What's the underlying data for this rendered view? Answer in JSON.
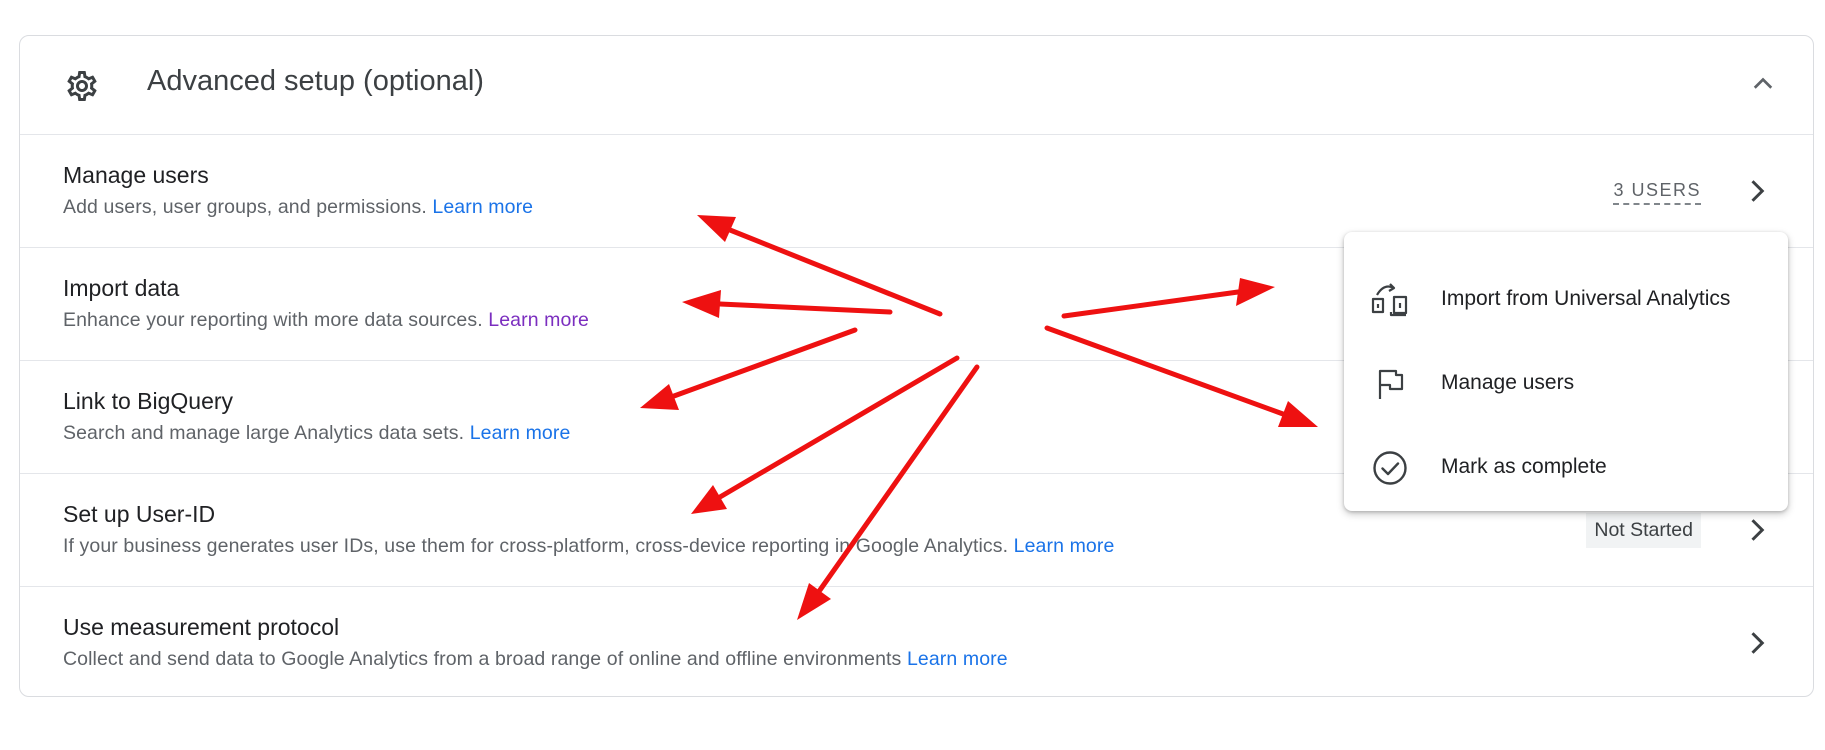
{
  "header": {
    "title": "Advanced setup (optional)",
    "icon": "gear-icon",
    "collapse_icon": "chevron-up-icon"
  },
  "rows": [
    {
      "name": "Manage users",
      "description": "Add users, user groups, and permissions.",
      "link": "Learn more",
      "badge": "3 USERS"
    },
    {
      "name": "Import data",
      "description": "Enhance your reporting with more data sources.",
      "link": "Learn more"
    },
    {
      "name": "Link to BigQuery",
      "description": "Search and manage large Analytics data sets.",
      "link": "Learn more"
    },
    {
      "name": "Set up User-ID",
      "description": "If your business generates user IDs, use them for cross-platform, cross-device reporting in Google Analytics.",
      "link": "Learn more",
      "status": "Not Started"
    },
    {
      "name": "Use measurement protocol",
      "description": "Collect and send data to Google Analytics from a broad range of online and offline environments",
      "link": "Learn more"
    }
  ],
  "menu": {
    "items": [
      {
        "label": "Import from Universal Analytics",
        "icon": "import-icon"
      },
      {
        "label": "Manage users",
        "icon": "flag-icon"
      },
      {
        "label": "Mark as complete",
        "icon": "check-circle-icon"
      }
    ]
  },
  "colors": {
    "link": "#1a73e8",
    "link_visited": "#7b2ebf",
    "annotation_arrows": "#ff0000",
    "border": "#dadce0"
  }
}
